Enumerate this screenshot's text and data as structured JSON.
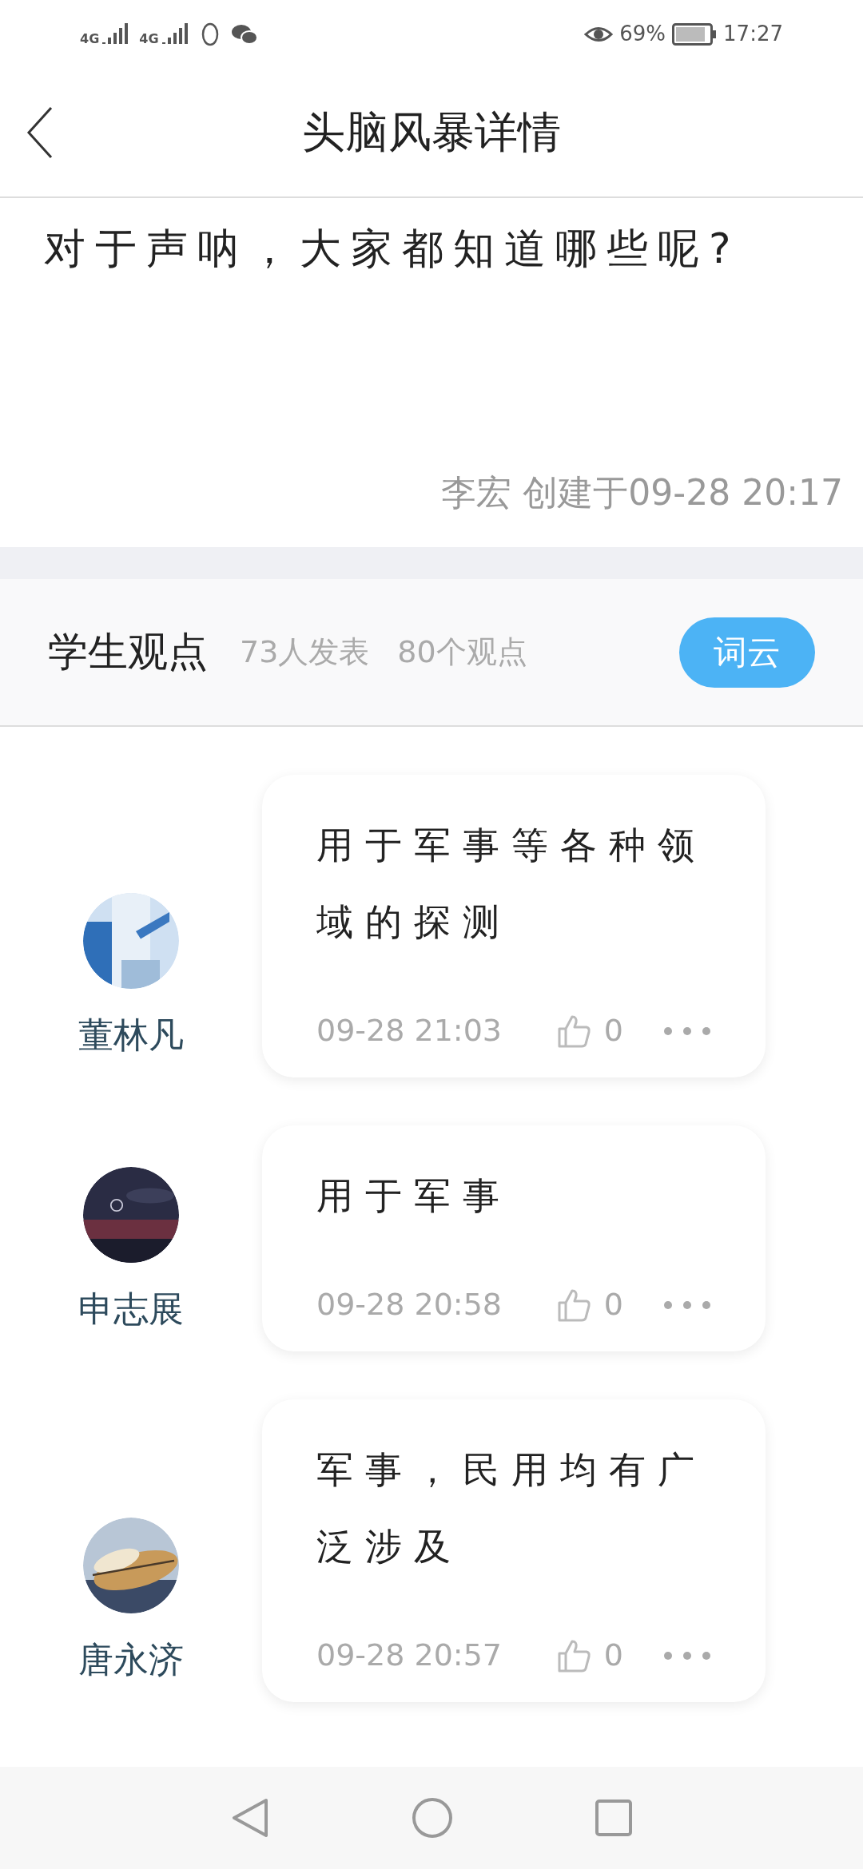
{
  "status_bar": {
    "network_1": "4G",
    "network_2": "4G",
    "battery": "69%",
    "time": "17:27"
  },
  "header": {
    "title": "头脑风暴详情"
  },
  "question": {
    "text": "对于声呐，大家都知道哪些呢?",
    "author_line": "李宏 创建于09-28 20:17"
  },
  "section": {
    "title": "学生观点",
    "participants": "73人发表",
    "count": "80个观点",
    "word_cloud_button": "词云"
  },
  "opinions": [
    {
      "name": "董林凡",
      "text": "用于军事等各种领域的探测",
      "time": "09-28 21:03",
      "likes": "0"
    },
    {
      "name": "申志展",
      "text": "用于军事",
      "time": "09-28 20:58",
      "likes": "0"
    },
    {
      "name": "唐永济",
      "text": "军事，民用均有广泛涉及",
      "time": "09-28 20:57",
      "likes": "0"
    }
  ]
}
